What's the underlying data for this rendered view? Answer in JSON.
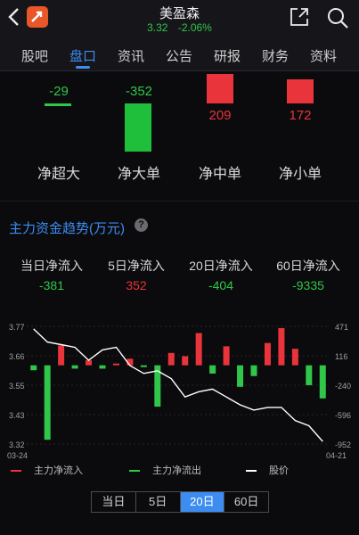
{
  "header": {
    "title": "美盈森",
    "price": "3.32",
    "change": "-2.06%"
  },
  "tabs": [
    {
      "label": "股吧"
    },
    {
      "label": "盘口",
      "active": true
    },
    {
      "label": "资讯"
    },
    {
      "label": "公告"
    },
    {
      "label": "研报"
    },
    {
      "label": "财务"
    },
    {
      "label": "资料"
    }
  ],
  "top_flows": [
    {
      "label": "净超大",
      "value": "-29",
      "num": -29
    },
    {
      "label": "净大单",
      "value": "-352",
      "num": -352
    },
    {
      "label": "净中单",
      "value": "209",
      "num": 209
    },
    {
      "label": "净小单",
      "value": "172",
      "num": 172
    }
  ],
  "section": {
    "title": "主力资金趋势(万元)",
    "help": "?"
  },
  "stats": [
    {
      "label": "当日净流入",
      "value": "-381",
      "color": "#2fc64a"
    },
    {
      "label": "5日净流入",
      "value": "352",
      "color": "#e8343a"
    },
    {
      "label": "20日净流入",
      "value": "-404",
      "color": "#2fc64a"
    },
    {
      "label": "60日净流入",
      "value": "-9335",
      "color": "#2fc64a"
    }
  ],
  "chart_data": {
    "type": "bar",
    "left_ticks": [
      "3.77",
      "3.66",
      "3.55",
      "3.43",
      "3.32"
    ],
    "right_ticks": [
      "471",
      "116",
      "-240",
      "-596",
      "-952"
    ],
    "x_start": "03-24",
    "x_end": "04-21",
    "ylim_flow": [
      -952,
      471
    ],
    "ylim_price": [
      3.32,
      3.77
    ],
    "flows": [
      -60,
      -900,
      240,
      -40,
      60,
      -40,
      0,
      80,
      -20,
      -500,
      150,
      110,
      390,
      -100,
      230,
      -260,
      -130,
      270,
      450,
      200,
      -240,
      -400
    ],
    "prices": [
      3.76,
      3.71,
      3.7,
      3.69,
      3.64,
      3.68,
      3.69,
      3.62,
      3.59,
      3.6,
      3.57,
      3.5,
      3.52,
      3.53,
      3.5,
      3.47,
      3.45,
      3.46,
      3.46,
      3.41,
      3.39,
      3.33
    ],
    "legend": [
      {
        "name": "主力净流入",
        "color": "#e8343a"
      },
      {
        "name": "主力净流出",
        "color": "#2fc64a"
      },
      {
        "name": "股价",
        "color": "#ffffff"
      }
    ]
  },
  "periods": [
    {
      "label": "当日"
    },
    {
      "label": "5日"
    },
    {
      "label": "20日",
      "active": true
    },
    {
      "label": "60日"
    }
  ],
  "colors": {
    "accent": "#3d8cf0",
    "up": "#e8343a",
    "down": "#2fc64a"
  }
}
